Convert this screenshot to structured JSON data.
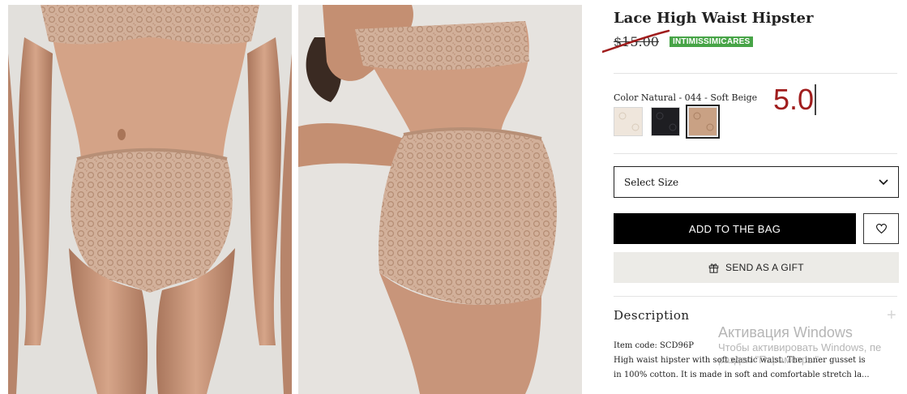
{
  "product": {
    "title": "Lace High Waist Hipster",
    "old_price": "$15.00",
    "promo_badge": "INTIMISSIMICARES",
    "color_label": "Color Natural - 044 - Soft Beige",
    "swatches": [
      {
        "name": "ivory",
        "color": "#efe6dc"
      },
      {
        "name": "black",
        "color": "#1e1e22"
      },
      {
        "name": "soft-beige",
        "color": "#c9a184",
        "selected": true
      }
    ],
    "rating_input": "5.0"
  },
  "size_select": {
    "placeholder": "Select Size"
  },
  "buttons": {
    "add_to_bag": "ADD TO THE BAG",
    "send_gift": "SEND AS A GIFT"
  },
  "description": {
    "title": "Description",
    "item_code": "Item code: SCD96P",
    "lines": [
      "High waist hipster with soft elastic waist. The inner gusset is",
      "in 100% cotton. It is made in soft and comfortable stretch la..."
    ]
  },
  "watermark": {
    "title": "Активация Windows",
    "line1": "Чтобы активировать Windows, пе",
    "line2": "раздел \"Параметры\"."
  },
  "colors": {
    "promo": "#47a447",
    "strike": "#a01d1d",
    "lace": "#d0ad95",
    "skin": "#c9967a",
    "backdrop": "#e4e2df"
  }
}
